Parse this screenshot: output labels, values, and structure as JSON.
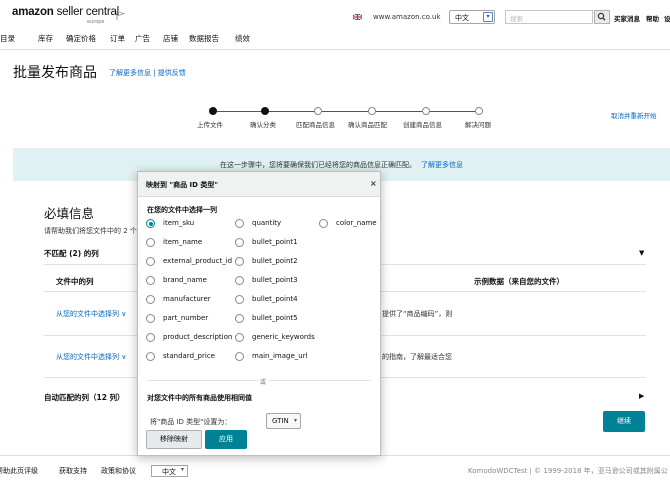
{
  "header": {
    "logo_brand": "amazon",
    "logo_product": " seller central",
    "logo_region": "europe",
    "marketplace_domain": "www.amazon.co.uk",
    "language": "中文",
    "search_placeholder": "搜索",
    "links": [
      "买家消息",
      "帮助",
      "设"
    ]
  },
  "nav": [
    "目录",
    "库存",
    "确定价格",
    "订单",
    "广告",
    "店铺",
    "数据报告",
    "绩效"
  ],
  "page": {
    "title": "批量发布商品",
    "links": "了解更多信息 | 提供反馈"
  },
  "stepper": {
    "steps": [
      {
        "label": "上传文件",
        "done": true
      },
      {
        "label": "确认分类",
        "done": true
      },
      {
        "label": "匹配商品信息",
        "done": false
      },
      {
        "label": "确认商品匹配",
        "done": false
      },
      {
        "label": "创建商品信息",
        "done": false
      },
      {
        "label": "解决问题",
        "done": false
      }
    ],
    "cancel_link": "取消并重新开始"
  },
  "banner": {
    "text": "在这一步骤中，您将要确保我们已经将您的商品信息正确匹配。",
    "link": "了解更多信息"
  },
  "required": {
    "title": "必填信息",
    "hint": "请帮助我们将您文件中的 2 个",
    "mismatch_heading": "不匹配 (2) 的列",
    "col_file": "文件中的列",
    "col_example": "示例数据（来自您的文件）",
    "rows": [
      {
        "select": "从您的文件中选择列 ∨",
        "desc": "提供了“商品编码”，则"
      },
      {
        "select": "从您的文件中选择列 ∨",
        "desc": "的指南，了解最适合您"
      }
    ],
    "auto_heading": "自动匹配的列（12 列）",
    "continue": "继续"
  },
  "footer": {
    "links": [
      "帮助此页评级",
      "获取支持",
      "政策和协议"
    ],
    "language": "中文",
    "right": "KomodoWDCTest   |   © 1999-2018 年，亚马逊公司或其附属公"
  },
  "modal": {
    "title": "映射到 \"商品 ID 类型\"",
    "close": "×",
    "subtitle": "在您的文件中选择一列",
    "options_col1": [
      "item_sku",
      "item_name",
      "external_product_id",
      "brand_name",
      "manufacturer",
      "part_number",
      "product_description",
      "standard_price"
    ],
    "options_col2": [
      "quantity",
      "bullet_point1",
      "bullet_point2",
      "bullet_point3",
      "bullet_point4",
      "bullet_point5",
      "generic_keywords",
      "main_image_url"
    ],
    "options_col3": [
      "color_name"
    ],
    "selected": "item_sku",
    "divider": "或",
    "apply_all_heading": "对您文件中的所有商品使用相同值",
    "set_label": "将\"商品 ID 类型\"设置为：",
    "set_value": "GTIN",
    "remove_button": "移除映射",
    "apply_button": "应用"
  },
  "colors": {
    "accent": "#008296",
    "link": "#0066c0",
    "banner": "#dff1f3"
  }
}
